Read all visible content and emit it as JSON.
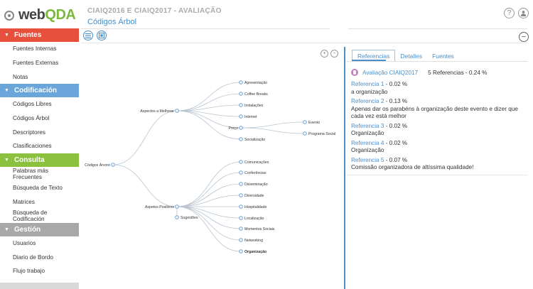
{
  "header": {
    "logo_text": "webQDA",
    "project_title": "CIAIQ2016 E CIAIQ2017 - AVALIAÇÃO",
    "page_title": "Códigos Árbol",
    "help_icon": "question-icon",
    "user_icon": "user-icon"
  },
  "sidebar": {
    "sections": [
      {
        "title": "Fuentes",
        "color": "#e8503e",
        "items": [
          "Fuentes Internas",
          "Fuentes Externas",
          "Notas"
        ]
      },
      {
        "title": "Codificación",
        "color": "#6aa6d9",
        "items": [
          "Códigos Libres",
          "Códigos Árbol",
          "Descriptores",
          "Clasificaciones"
        ]
      },
      {
        "title": "Consulta",
        "color": "#8cc13f",
        "items": [
          "Palabras más Frecuentes",
          "Búsqueda de Texto",
          "Matrices",
          "Búsqueda de Codificación"
        ]
      },
      {
        "title": "Gestión",
        "color": "#a8a8a8",
        "items": [
          "Usuarios",
          "Diario de Bordo",
          "Flujo trabajo"
        ]
      }
    ]
  },
  "toolbar": {
    "menu_icon": "menu-icon",
    "tree_icon": "tree-icon",
    "collapse_icon": "minus-icon",
    "zoom_in_icon": "zoom-in-icon",
    "zoom_out_icon": "zoom-out-icon"
  },
  "tree": {
    "root": "Códigos Árvore",
    "branches": [
      {
        "label": "Aspectos a Melhorar",
        "children": [
          {
            "label": "Apresentação"
          },
          {
            "label": "Coffee Breaks"
          },
          {
            "label": "Instalações"
          },
          {
            "label": "Internet"
          },
          {
            "label": "Preço",
            "children": [
              {
                "label": "Evento"
              },
              {
                "label": "Programa Social"
              }
            ]
          },
          {
            "label": "Socialização"
          }
        ]
      },
      {
        "label": "Aspetos Positivos",
        "children": [
          {
            "label": "Comunicações"
          },
          {
            "label": "Conferências"
          },
          {
            "label": "Disseminação"
          },
          {
            "label": "Diversidade"
          },
          {
            "label": "Hospitalidade"
          },
          {
            "label": "Localização"
          },
          {
            "label": "Momentos Sociais"
          },
          {
            "label": "Networking"
          },
          {
            "label": "Organização",
            "bold": true
          },
          {
            "label": "Sugestões",
            "sub": true
          }
        ]
      }
    ]
  },
  "panel": {
    "tabs": [
      {
        "label": "Referencias",
        "active": true
      },
      {
        "label": "Detalles",
        "active": false
      },
      {
        "label": "Fuentes",
        "active": false
      }
    ],
    "source": {
      "name": "Avaliação CIAIQ2017",
      "count": "5 Referencias - 0.24 %"
    },
    "references": [
      {
        "label": "Referencia 1",
        "pct": " - 0.02 %",
        "text": "a organização"
      },
      {
        "label": "Referencia 2",
        "pct": " - 0.13 %",
        "text": "Apenas dar os parabéns à organização deste evento e dizer que cada vez está melhor"
      },
      {
        "label": "Referencia 3",
        "pct": " - 0.02 %",
        "text": "Organização"
      },
      {
        "label": "Referencia 4",
        "pct": " - 0.02 %",
        "text": "Organização"
      },
      {
        "label": "Referencia 5",
        "pct": " - 0.07 %",
        "text": "Comissão organizadora de altíssima qualidade!"
      }
    ]
  }
}
